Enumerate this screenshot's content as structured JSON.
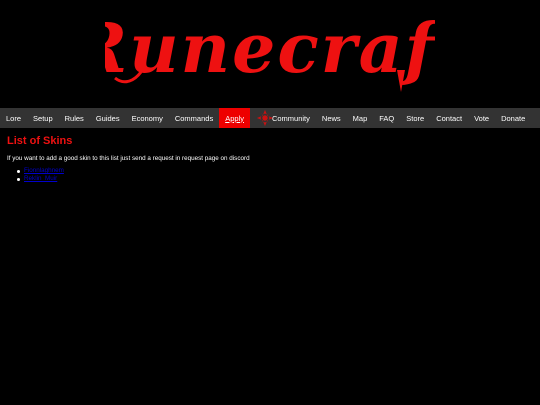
{
  "site": {
    "logo_text": "Runecraft",
    "brand_color": "#ee1111"
  },
  "nav": {
    "items": [
      {
        "label": "Lore"
      },
      {
        "label": "Setup"
      },
      {
        "label": "Rules"
      },
      {
        "label": "Guides"
      },
      {
        "label": "Economy"
      },
      {
        "label": "Commands"
      },
      {
        "label": "Apply"
      },
      {
        "label": "Community"
      },
      {
        "label": "News"
      },
      {
        "label": "Map"
      },
      {
        "label": "FAQ"
      },
      {
        "label": "Store"
      },
      {
        "label": "Contact"
      },
      {
        "label": "Vote"
      },
      {
        "label": "Donate"
      }
    ],
    "active_label": "Apply",
    "active_color": "#ee0000",
    "bar_color": "#333333"
  },
  "main": {
    "title": "List of Skins",
    "description": "If you want to add a good skin to this list just send a request in request page on discord",
    "skins": [
      {
        "label": "Fionnlaghnem"
      },
      {
        "label": "Reklin_Muir"
      }
    ]
  }
}
